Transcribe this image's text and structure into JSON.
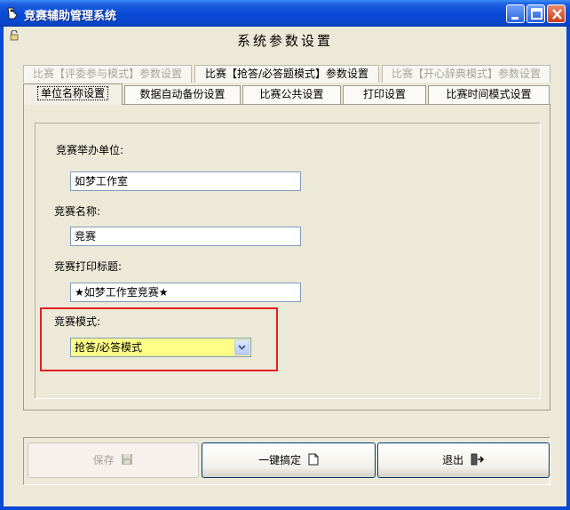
{
  "window": {
    "title": "竞赛辅助管理系统"
  },
  "page": {
    "title": "系统参数设置"
  },
  "tabs_row1": [
    {
      "label": "比赛【评委参与模式】参数设置",
      "enabled": false
    },
    {
      "label": "比赛【抢答/必答题模式】参数设置",
      "enabled": true
    },
    {
      "label": "比赛【开心辞典模式】参数设置",
      "enabled": false
    }
  ],
  "tabs_row2": [
    {
      "label": "单位名称设置",
      "active": true
    },
    {
      "label": "数据自动备份设置",
      "active": false
    },
    {
      "label": "比赛公共设置",
      "active": false
    },
    {
      "label": "打印设置",
      "active": false
    },
    {
      "label": "比赛时间模式设置",
      "active": false
    }
  ],
  "form": {
    "organizer_label": "竞赛举办单位:",
    "organizer_value": "如梦工作室",
    "name_label": "竞赛名称:",
    "name_value": "竞赛",
    "print_title_label": "竞赛打印标题:",
    "print_title_value": "★如梦工作室竞赛★",
    "mode_label": "竞赛模式:",
    "mode_value": "抢答/必答模式"
  },
  "buttons": {
    "save_label": "保存",
    "one_click_label": "一键搞定",
    "exit_label": "退出"
  },
  "colors": {
    "highlight": "#e02020",
    "combo_background": "#ffff88",
    "titlebar": "#0a4ad8"
  }
}
